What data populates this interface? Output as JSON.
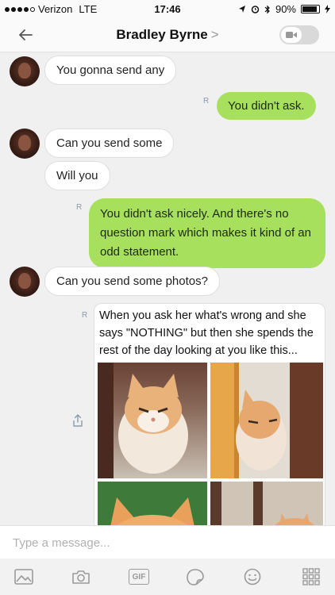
{
  "status_bar": {
    "carrier": "Verizon",
    "network": "LTE",
    "time": "17:46",
    "battery": "90%",
    "battery_level": 0.9
  },
  "header": {
    "title": "Bradley Byrne",
    "chevron": ">"
  },
  "messages": [
    {
      "direction": "in",
      "text": "You gonna send any"
    },
    {
      "direction": "out",
      "text": "You didn't ask.",
      "read": "R"
    },
    {
      "direction": "in",
      "text": "Can you send some"
    },
    {
      "direction": "in",
      "text": "Will you"
    },
    {
      "direction": "out",
      "text": "You didn't ask nicely. And there's no question mark which makes it kind of an odd statement.",
      "read": "R"
    },
    {
      "direction": "in",
      "text": "Can you send some photos?"
    },
    {
      "direction": "out",
      "type": "image",
      "caption": "When you ask her what's wrong and she says \"NOTHING\" but then she spends the rest of the day looking at you like this...",
      "read": "R"
    }
  ],
  "composer": {
    "placeholder": "Type a message..."
  },
  "toolbar": {
    "gif_label": "GIF",
    "icons": [
      "image-icon",
      "camera-icon",
      "gif-icon",
      "sticker-icon",
      "emoji-icon",
      "apps-grid-icon"
    ]
  },
  "colors": {
    "outgoing_bubble": "#a6e05c",
    "incoming_bubble": "#ffffff",
    "background": "#f0f0f0"
  }
}
